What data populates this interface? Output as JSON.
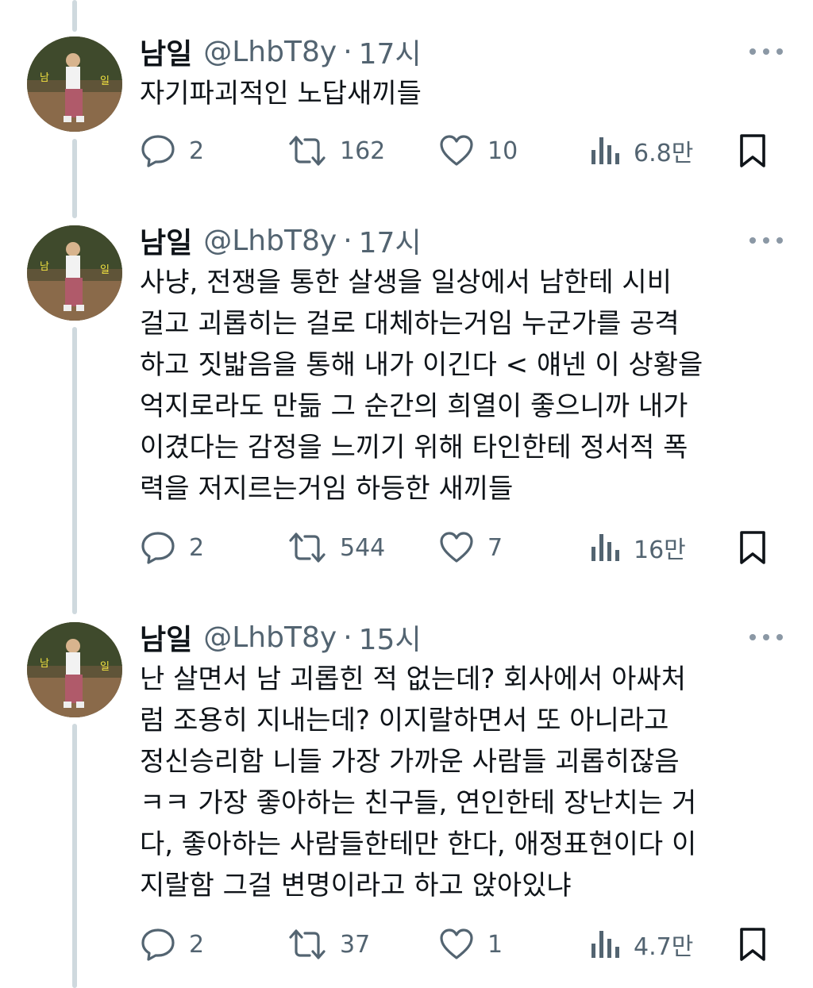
{
  "tweets": [
    {
      "name": "남일",
      "handle": "@LhbT8y",
      "separator": "·",
      "time": "17시",
      "text": "자기파괴적인 노답새끼들",
      "replies": "2",
      "retweets": "162",
      "likes": "10",
      "views": "6.8만"
    },
    {
      "name": "남일",
      "handle": "@LhbT8y",
      "separator": "·",
      "time": "17시",
      "text": "사냥, 전쟁을 통한 살생을 일상에서 남한테 시비\n걸고 괴롭히는 걸로 대체하는거임 누군가를 공격\n하고 짓밟음을 통해 내가 이긴다 < 얘넨 이 상황을\n억지로라도 만듦 그 순간의 희열이 좋으니까 내가\n이겼다는 감정을 느끼기 위해 타인한테 정서적 폭\n력을 저지르는거임 하등한 새끼들",
      "replies": "2",
      "retweets": "544",
      "likes": "7",
      "views": "16만"
    },
    {
      "name": "남일",
      "handle": "@LhbT8y",
      "separator": "·",
      "time": "15시",
      "text": "난 살면서 남 괴롭힌 적 없는데? 회사에서 아싸처\n럼 조용히 지내는데? 이지랄하면서 또 아니라고\n정신승리함 니들 가장 가까운 사람들 괴롭히잖음\nㅋㅋ 가장 좋아하는 친구들, 연인한테 장난치는 거\n다, 좋아하는 사람들한테만 한다, 애정표현이다 이\n지랄함 그걸 변명이라고 하고 앉아있냐",
      "replies": "2",
      "retweets": "37",
      "likes": "1",
      "views": "4.7만"
    }
  ],
  "icons": {
    "reply": "speech-bubble-icon",
    "retweet": "retweet-arrows-icon",
    "like": "heart-icon",
    "views": "bar-chart-icon",
    "bookmark": "bookmark-icon",
    "more": "ellipsis-icon"
  },
  "colors": {
    "text": "#0f1419",
    "secondary": "#536471",
    "thread_line": "#cfd9de"
  }
}
